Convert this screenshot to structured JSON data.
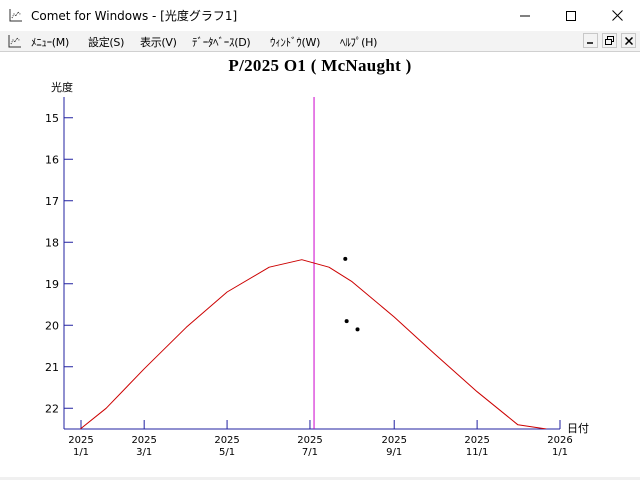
{
  "window": {
    "title": "Comet for Windows - [光度グラフ1]",
    "controls": [
      "minimize",
      "maximize",
      "close"
    ]
  },
  "menubar": {
    "items": [
      {
        "label": "ﾒﾆｭｰ(M)"
      },
      {
        "label": "設定(S)"
      },
      {
        "label": "表示(V)"
      },
      {
        "label": "ﾃﾞｰﾀﾍﾞｰｽ(D)"
      },
      {
        "label": "ｳｨﾝﾄﾞｳ(W)"
      },
      {
        "label": "ﾍﾙﾌﾟ(H)"
      }
    ],
    "mdi_controls": [
      "minimize",
      "restore",
      "close"
    ]
  },
  "chart_data": {
    "type": "line",
    "title": "P/2025 O1 ( McNaught )",
    "ylabel": "光度",
    "xlabel": "日付",
    "ylim": [
      22.5,
      14.5
    ],
    "y_inverted": true,
    "yticks": [
      15,
      16,
      17,
      18,
      19,
      20,
      21,
      22
    ],
    "xlim": [
      "2025-01-01",
      "2026-01-01"
    ],
    "xticks": [
      {
        "year": "2025",
        "date": "1/1"
      },
      {
        "year": "2025",
        "date": "3/1"
      },
      {
        "year": "2025",
        "date": "5/1"
      },
      {
        "year": "2025",
        "date": "7/1"
      },
      {
        "year": "2025",
        "date": "9/1"
      },
      {
        "year": "2025",
        "date": "11/1"
      },
      {
        "year": "2026",
        "date": "1/1"
      }
    ],
    "today_line": "2025-07-04",
    "series": [
      {
        "kind": "predicted",
        "color": "#cc0000",
        "x": [
          "2025-01-13",
          "2025-02-01",
          "2025-03-01",
          "2025-04-01",
          "2025-05-01",
          "2025-06-01",
          "2025-06-25",
          "2025-07-15",
          "2025-08-01",
          "2025-09-01",
          "2025-10-01",
          "2025-11-01",
          "2025-12-01",
          "2025-12-22"
        ],
        "y": [
          22.6,
          22.0,
          21.05,
          20.05,
          19.2,
          18.6,
          18.42,
          18.6,
          18.95,
          19.8,
          20.7,
          21.6,
          22.4,
          22.6
        ]
      },
      {
        "kind": "observed",
        "color": "#000000",
        "x": [
          "2025-07-27",
          "2025-07-28",
          "2025-08-05"
        ],
        "y": [
          18.4,
          19.9,
          20.1
        ]
      }
    ],
    "colors": {
      "axis": "#2020a0",
      "today": "#cc00cc"
    }
  }
}
